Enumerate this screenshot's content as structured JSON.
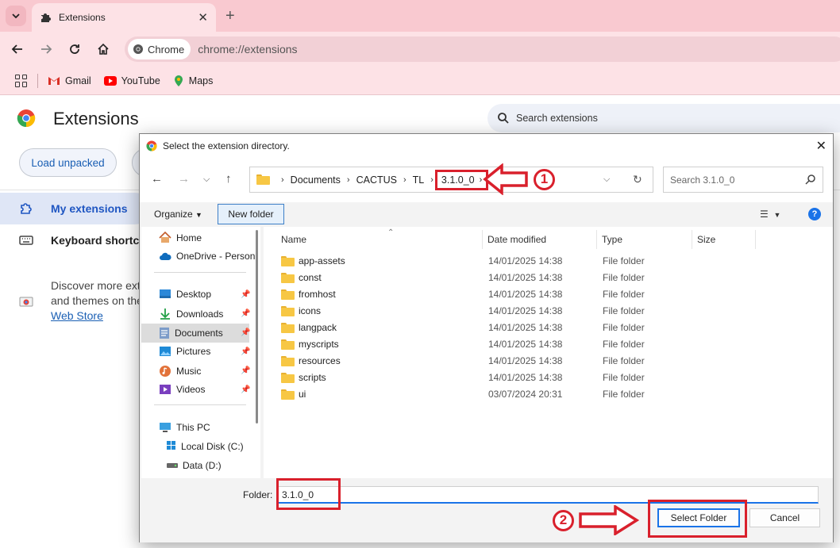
{
  "browser": {
    "tab": {
      "title": "Extensions"
    },
    "omnibox": {
      "chip": "Chrome",
      "url": "chrome://extensions"
    },
    "bookmarks": [
      {
        "label": "Gmail",
        "icon": "gmail-icon"
      },
      {
        "label": "YouTube",
        "icon": "youtube-icon"
      },
      {
        "label": "Maps",
        "icon": "maps-icon"
      }
    ]
  },
  "page": {
    "title": "Extensions",
    "search_placeholder": "Search extensions",
    "load_unpacked": "Load unpacked",
    "sidebar": [
      {
        "label": "My extensions",
        "icon": "extensions-icon",
        "active": true
      },
      {
        "label": "Keyboard shortcu",
        "icon": "keyboard-icon",
        "active": false
      }
    ],
    "discover": {
      "line1": "Discover more ext",
      "line2": "and themes on the",
      "link": "Web Store"
    }
  },
  "dialog": {
    "title": "Select the extension directory.",
    "breadcrumbs": [
      "Documents",
      "CACTUS",
      "TL",
      "3.1.0_0"
    ],
    "search_placeholder": "Search 3.1.0_0",
    "annotation_1": "1",
    "annotation_2": "2",
    "commands": {
      "organize": "Organize",
      "new_folder": "New folder"
    },
    "nav": {
      "home": "Home",
      "onedrive": "OneDrive - Person",
      "desktop": "Desktop",
      "downloads": "Downloads",
      "documents": "Documents",
      "pictures": "Pictures",
      "music": "Music",
      "videos": "Videos",
      "thispc": "This PC",
      "localdisk": "Local Disk (C:)",
      "data": "Data (D:)"
    },
    "columns": {
      "name": "Name",
      "date": "Date modified",
      "type": "Type",
      "size": "Size"
    },
    "files": [
      {
        "name": "app-assets",
        "date": "14/01/2025 14:38",
        "type": "File folder"
      },
      {
        "name": "const",
        "date": "14/01/2025 14:38",
        "type": "File folder"
      },
      {
        "name": "fromhost",
        "date": "14/01/2025 14:38",
        "type": "File folder"
      },
      {
        "name": "icons",
        "date": "14/01/2025 14:38",
        "type": "File folder"
      },
      {
        "name": "langpack",
        "date": "14/01/2025 14:38",
        "type": "File folder"
      },
      {
        "name": "myscripts",
        "date": "14/01/2025 14:38",
        "type": "File folder"
      },
      {
        "name": "resources",
        "date": "14/01/2025 14:38",
        "type": "File folder"
      },
      {
        "name": "scripts",
        "date": "14/01/2025 14:38",
        "type": "File folder"
      },
      {
        "name": "ui",
        "date": "03/07/2024 20:31",
        "type": "File folder"
      }
    ],
    "folder_label": "Folder:",
    "folder_value": "3.1.0_0",
    "select_button": "Select Folder",
    "cancel_button": "Cancel"
  },
  "colors": {
    "tabstrip": "#f9c9d0",
    "toolbar": "#fde2e6",
    "accent": "#1a73e8",
    "annotation": "#d9202c"
  }
}
